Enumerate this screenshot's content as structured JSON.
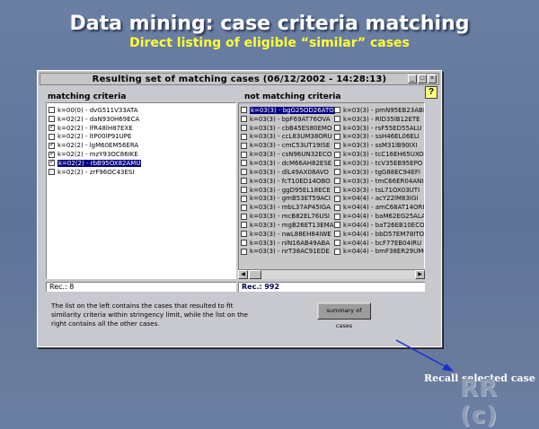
{
  "slide": {
    "title": "Data mining: case criteria matching",
    "subtitle": "Direct listing of eligible “similar” cases"
  },
  "window": {
    "title": "Resulting set of matching cases (06/12/2002 - 14:28:13)",
    "help_label": "?"
  },
  "matching": {
    "label": "matching criteria",
    "rec_label": "Rec.: 8",
    "items": [
      {
        "text": "k=00(0) - dvG511V33ATA",
        "checked": false,
        "selected": false
      },
      {
        "text": "k=02(2) - daN930H69ECA",
        "checked": false,
        "selected": false
      },
      {
        "text": "k=02(2) - lfR48lH87EXE",
        "checked": true,
        "selected": false
      },
      {
        "text": "k=02(2) - ltP00lP91UPE",
        "checked": false,
        "selected": false
      },
      {
        "text": "k=02(2) - lgM60EM56ERA",
        "checked": true,
        "selected": false
      },
      {
        "text": "k=02(2) - mzY93OC86IKE",
        "checked": true,
        "selected": false
      },
      {
        "text": "k=02(2) - rbB95OX82AMU",
        "checked": true,
        "selected": true
      },
      {
        "text": "k=02(2) - zrF96OC43ESI",
        "checked": false,
        "selected": false
      }
    ]
  },
  "not_matching": {
    "label": "not matching criteria",
    "rec_label": "Rec.: 992",
    "col1": [
      {
        "text": "k=03(3) - bgG25OD26ATO",
        "selected": true
      },
      {
        "text": "k=03(3) - bpF69AT76OVA",
        "selected": false
      },
      {
        "text": "k=03(3) - cbB45ES80EMO",
        "selected": false
      },
      {
        "text": "k=03(3) - ccL83UM38ORU",
        "selected": false
      },
      {
        "text": "k=03(3) - cmC53UT19ISE",
        "selected": false
      },
      {
        "text": "k=03(3) - csN96UN32ECO",
        "selected": false
      },
      {
        "text": "k=03(3) - dcM66AH82ESE",
        "selected": false
      },
      {
        "text": "k=03(3) - dlL49AX08AVO",
        "selected": false
      },
      {
        "text": "k=03(3) - fcT10ED14OBO",
        "selected": false
      },
      {
        "text": "k=03(3) - ggD95EL18ECE",
        "selected": false
      },
      {
        "text": "k=03(3) - gmB53ET59ACI",
        "selected": false
      },
      {
        "text": "k=03(3) - mbL37AP45IGA",
        "selected": false
      },
      {
        "text": "k=03(3) - mcB82EL76USI",
        "selected": false
      },
      {
        "text": "k=03(3) - mgB26ET13EMA",
        "selected": false
      },
      {
        "text": "k=03(3) - nwL88EH84IWE",
        "selected": false
      },
      {
        "text": "k=03(3) - nlN16AB49ABA",
        "selected": false
      },
      {
        "text": "k=03(3) - nrT38AC91EDE",
        "selected": false
      }
    ],
    "col2": [
      {
        "text": "k=03(3) - pmN95EB23ABI"
      },
      {
        "text": "k=03(3) - RlD35lB12ETE"
      },
      {
        "text": "k=03(3) - rsF55ED55ALU"
      },
      {
        "text": "k=03(3) - ssH46EL06ELI"
      },
      {
        "text": "k=03(3) - ssM31lB90IXI"
      },
      {
        "text": "k=03(3) - tcC16EH65UXO"
      },
      {
        "text": "k=03(3) - tcV35EB95EPO"
      },
      {
        "text": "k=03(3) - tgG88EC94EFI"
      },
      {
        "text": "k=03(3) - tmC66ER04ANI"
      },
      {
        "text": "k=03(3) - tsL71OX03UTI"
      },
      {
        "text": "k=04(4) - acY22lM83IGI"
      },
      {
        "text": "k=04(4) - amC68AT14ORI"
      },
      {
        "text": "k=04(4) - baM62EG25ALA"
      },
      {
        "text": "k=04(4) - baT26EB10ECO"
      },
      {
        "text": "k=04(4) - bbD57EM78ITO"
      },
      {
        "text": "k=04(4) - bcF77EB04IRU"
      },
      {
        "text": "k=04(4) - bmF38ER29UMO"
      }
    ]
  },
  "note_text": "The list on the left contains the cases that resulted to fit similarity criteria within stringency limit, while the list on the right contains all the other cases.",
  "summary_button_label": "summary of cases",
  "recall_label": "Recall selected case",
  "watermark": "RR (c)",
  "colors": {
    "selection": "#000080",
    "slide_bg": "#6a7fa3",
    "subtitle": "#ffff33",
    "arrow": "#1a2fd0"
  }
}
